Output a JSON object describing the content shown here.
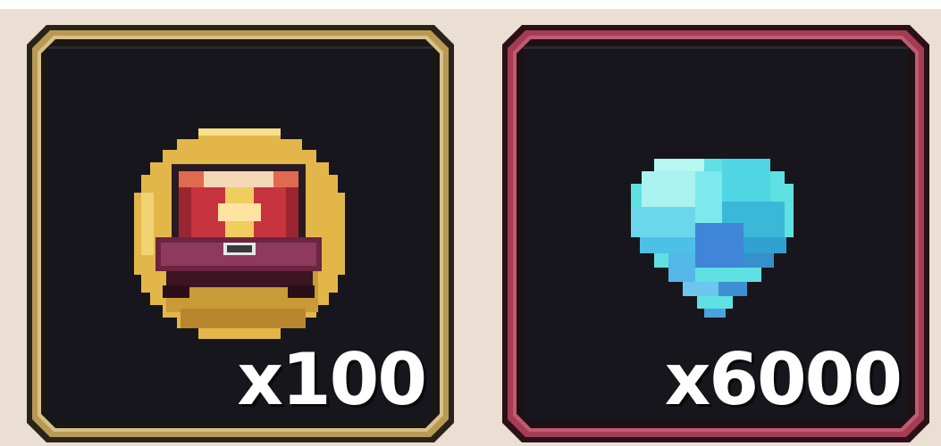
{
  "slots": [
    {
      "icon": "treasure-chest-coin-icon",
      "quantity_text": "x100",
      "frame_color": "#b99a55",
      "frame_dark": "#2a2418"
    },
    {
      "icon": "diamond-gem-icon",
      "quantity_text": "x6000",
      "frame_color": "#a33c55",
      "frame_dark": "#2b1016"
    }
  ],
  "colors": {
    "page_background": "#eadfd2",
    "panel_background": "#17161c",
    "quantity_text": "#ffffff"
  }
}
